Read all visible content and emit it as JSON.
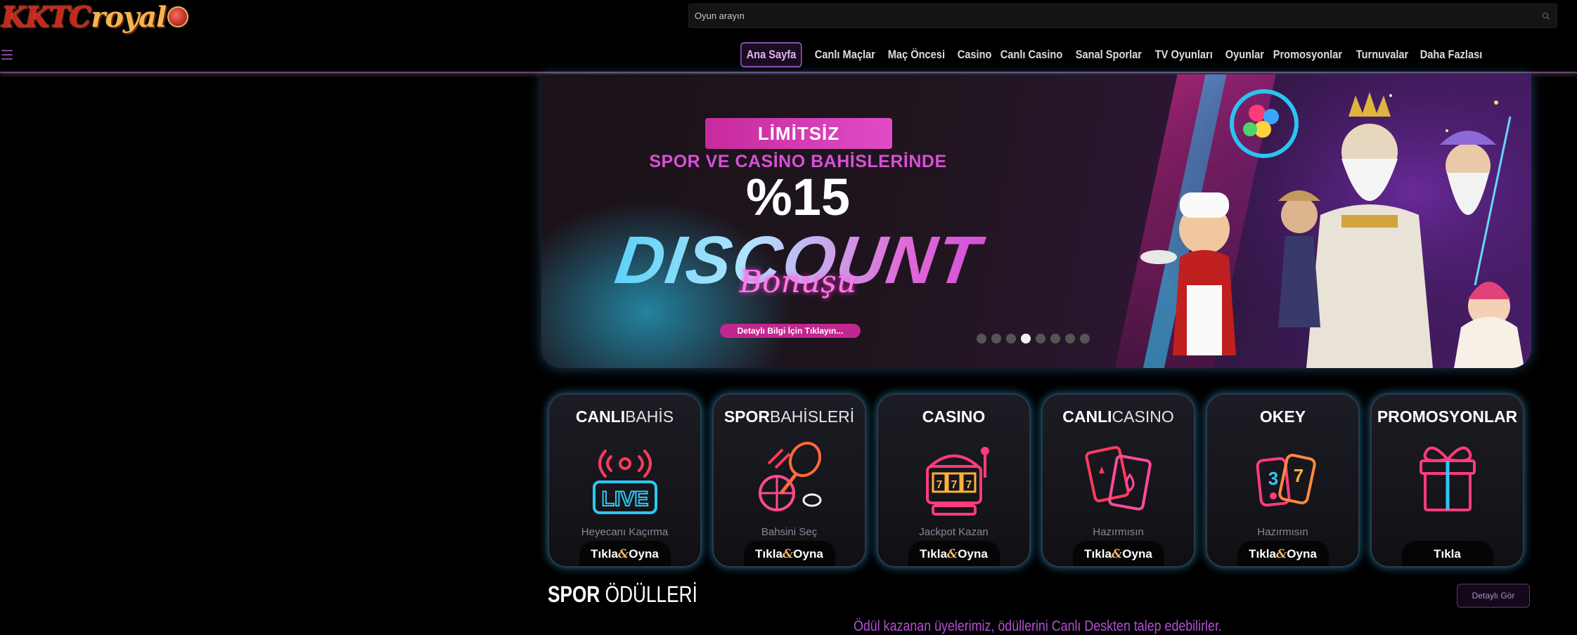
{
  "header": {
    "logo_text_a": "KKTC",
    "logo_text_b": "royal",
    "search_placeholder": "Oyun arayın"
  },
  "nav": {
    "items": [
      {
        "label": "Ana Sayfa",
        "active": true
      },
      {
        "label": "Canlı Maçlar"
      },
      {
        "label": "Maç Öncesi"
      },
      {
        "label": "Casino"
      },
      {
        "label": "Canlı Casino"
      },
      {
        "label": "Sanal Sporlar"
      },
      {
        "label": "TV Oyunları"
      },
      {
        "label": "Oyunlar"
      },
      {
        "label": "Promosyonlar"
      },
      {
        "label": "Turnuvalar"
      },
      {
        "label": "Daha Fazlası"
      }
    ]
  },
  "banner": {
    "tag": "LİMİTSİZ",
    "subtitle": "SPOR VE CASİNO BAHİSLERİNDE",
    "percent": "%15",
    "headline": "DISCOUNT",
    "script": "Bonuşu",
    "cta": "Detaylı Bilgi İçin Tıklayın...",
    "slide_count": 8,
    "active_slide": 4
  },
  "cards": [
    {
      "title_bold": "CANLI",
      "title_thin": "BAHİS",
      "sub": "Heyecanı Kaçırma",
      "btn_a": "Tıkla",
      "btn_amp": "&",
      "btn_b": "Oyna",
      "icon": "live-icon"
    },
    {
      "title_bold": "SPOR",
      "title_thin": "BAHİSLERİ",
      "sub": "Bahsini Seç",
      "btn_a": "Tıkla",
      "btn_amp": "&",
      "btn_b": "Oyna",
      "icon": "sports-icon"
    },
    {
      "title_bold": "CASINO",
      "title_thin": "",
      "sub": "Jackpot Kazan",
      "btn_a": "Tıkla",
      "btn_amp": "&",
      "btn_b": "Oyna",
      "icon": "slot-machine-icon"
    },
    {
      "title_bold": "CANLI",
      "title_thin": "CASINO",
      "sub": "Hazırmısın",
      "btn_a": "Tıkla",
      "btn_amp": "&",
      "btn_b": "Oyna",
      "icon": "cards-icon"
    },
    {
      "title_bold": "OKEY",
      "title_thin": "",
      "sub": "Hazırmısın",
      "btn_a": "Tıkla",
      "btn_amp": "&",
      "btn_b": "Oyna",
      "icon": "okey-tiles-icon"
    },
    {
      "title_bold": "PROMOSYONLAR",
      "title_thin": "",
      "sub": "",
      "btn_a": "Tıkla",
      "btn_amp": "",
      "btn_b": "",
      "icon": "gift-icon"
    }
  ],
  "spor": {
    "title_bold": "SPOR",
    "title_thin": "ÖDÜLLERİ",
    "detail_button": "Detaylı Gör",
    "note": "Ödül kazanan üyelerimiz, ödüllerini Canlı Deskten talep edebilirler."
  },
  "colors": {
    "accent_purple": "#8a4fb0",
    "neon_cyan": "#2ec7f2",
    "neon_pink": "#e04cc6"
  }
}
